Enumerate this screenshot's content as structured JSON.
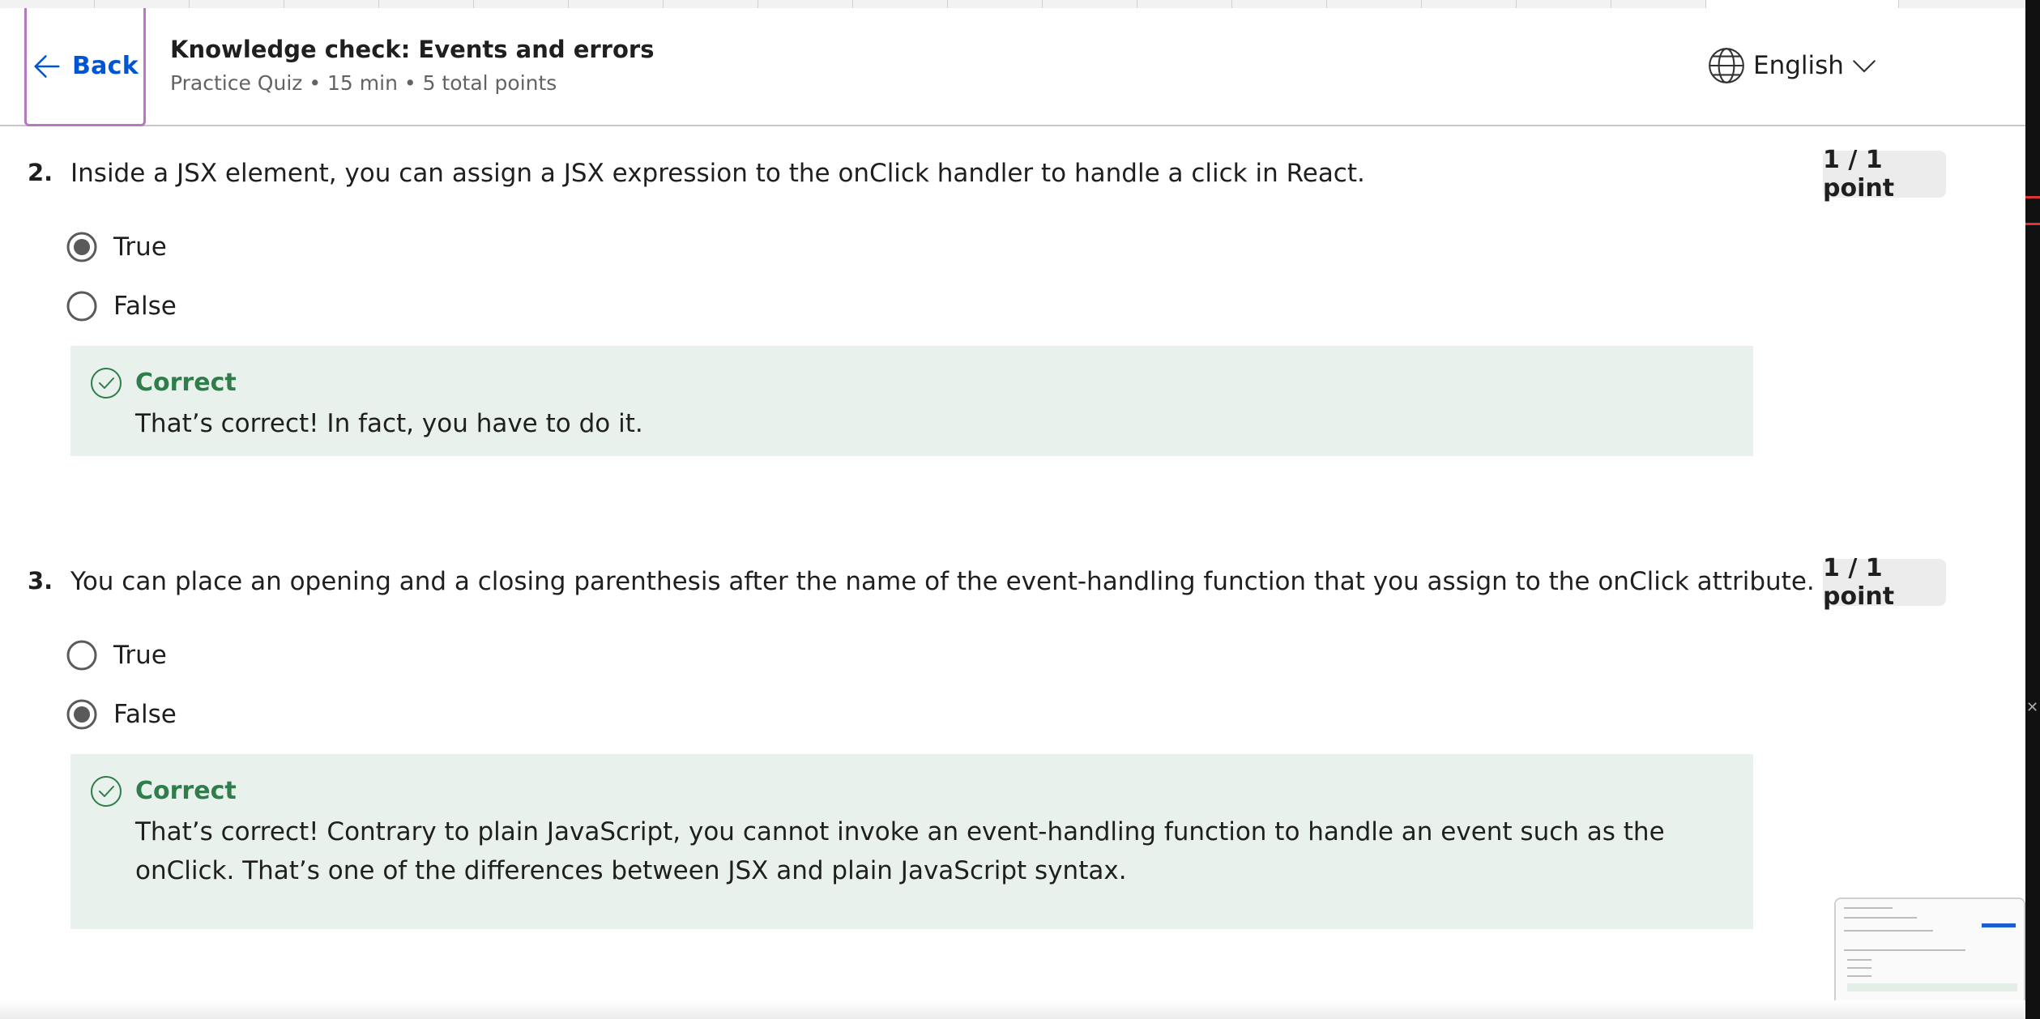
{
  "header": {
    "back_label": "Back",
    "title": "Knowledge check: Events and errors",
    "meta": "Practice Quiz • 15 min • 5 total points",
    "language": "English"
  },
  "questions": [
    {
      "number": "2.",
      "text": "Inside a JSX element, you can assign a JSX expression to the onClick handler to handle a click in React.",
      "score": "1 / 1 point",
      "options": [
        {
          "label": "True",
          "selected": true
        },
        {
          "label": "False",
          "selected": false
        }
      ],
      "feedback": {
        "title": "Correct",
        "text": "That’s correct! In fact, you have to do it."
      }
    },
    {
      "number": "3.",
      "text": "You can place an opening and a closing parenthesis after the name of the event-handling function that you assign to the onClick attribute.",
      "score": "1 / 1 point",
      "options": [
        {
          "label": "True",
          "selected": false
        },
        {
          "label": "False",
          "selected": true
        }
      ],
      "feedback": {
        "title": "Correct",
        "text": "That’s correct! Contrary to plain JavaScript, you cannot invoke an event-handling function to handle an event such as the onClick. That’s one of the differences between JSX and plain JavaScript syntax."
      }
    }
  ],
  "colors": {
    "link": "#0056d2",
    "correct_text": "#2e7d4a",
    "correct_bg": "#e8f1eb",
    "focus_outline": "#b678c0"
  }
}
